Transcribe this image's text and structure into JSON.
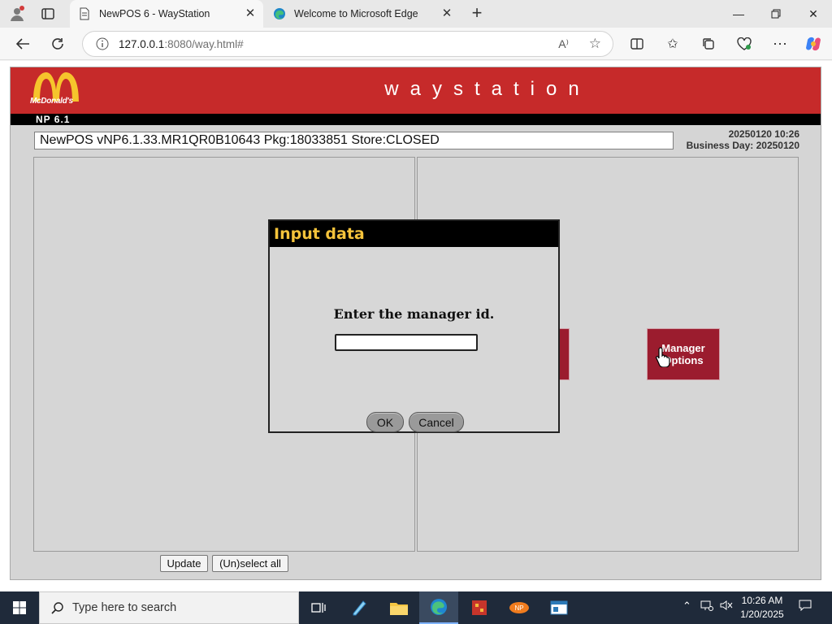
{
  "browser": {
    "tabs": [
      {
        "title": "NewPOS 6 - WayStation",
        "active": true
      },
      {
        "title": "Welcome to Microsoft Edge",
        "active": false
      }
    ],
    "address": {
      "host": "127.0.0.1",
      "path": ":8080/way.html#"
    }
  },
  "pos": {
    "brand_logo_text": "McDonald's",
    "title": "waystation",
    "version_label": "NP 6.1",
    "status_line": "NewPOS vNP6.1.33.MR1QR0B10643 Pkg:18033851 Store:CLOSED",
    "datetime": "20250120 10:26",
    "business_day": "Business Day: 20250120",
    "manager_button_label_1": "Manager",
    "manager_button_label_2": "Options",
    "update_button": "Update",
    "unselect_button": "(Un)select all"
  },
  "modal": {
    "title": "Input data",
    "prompt": "Enter the manager id.",
    "input_value": "",
    "ok_label": "OK",
    "cancel_label": "Cancel"
  },
  "taskbar": {
    "search_placeholder": "Type here to search",
    "time": "10:26 AM",
    "date": "1/20/2025"
  },
  "colors": {
    "header_red": "#c62a2a",
    "button_maroon": "#9b1c2e",
    "modal_title_text": "#f5c33b",
    "taskbar": "#1f2a3a"
  }
}
